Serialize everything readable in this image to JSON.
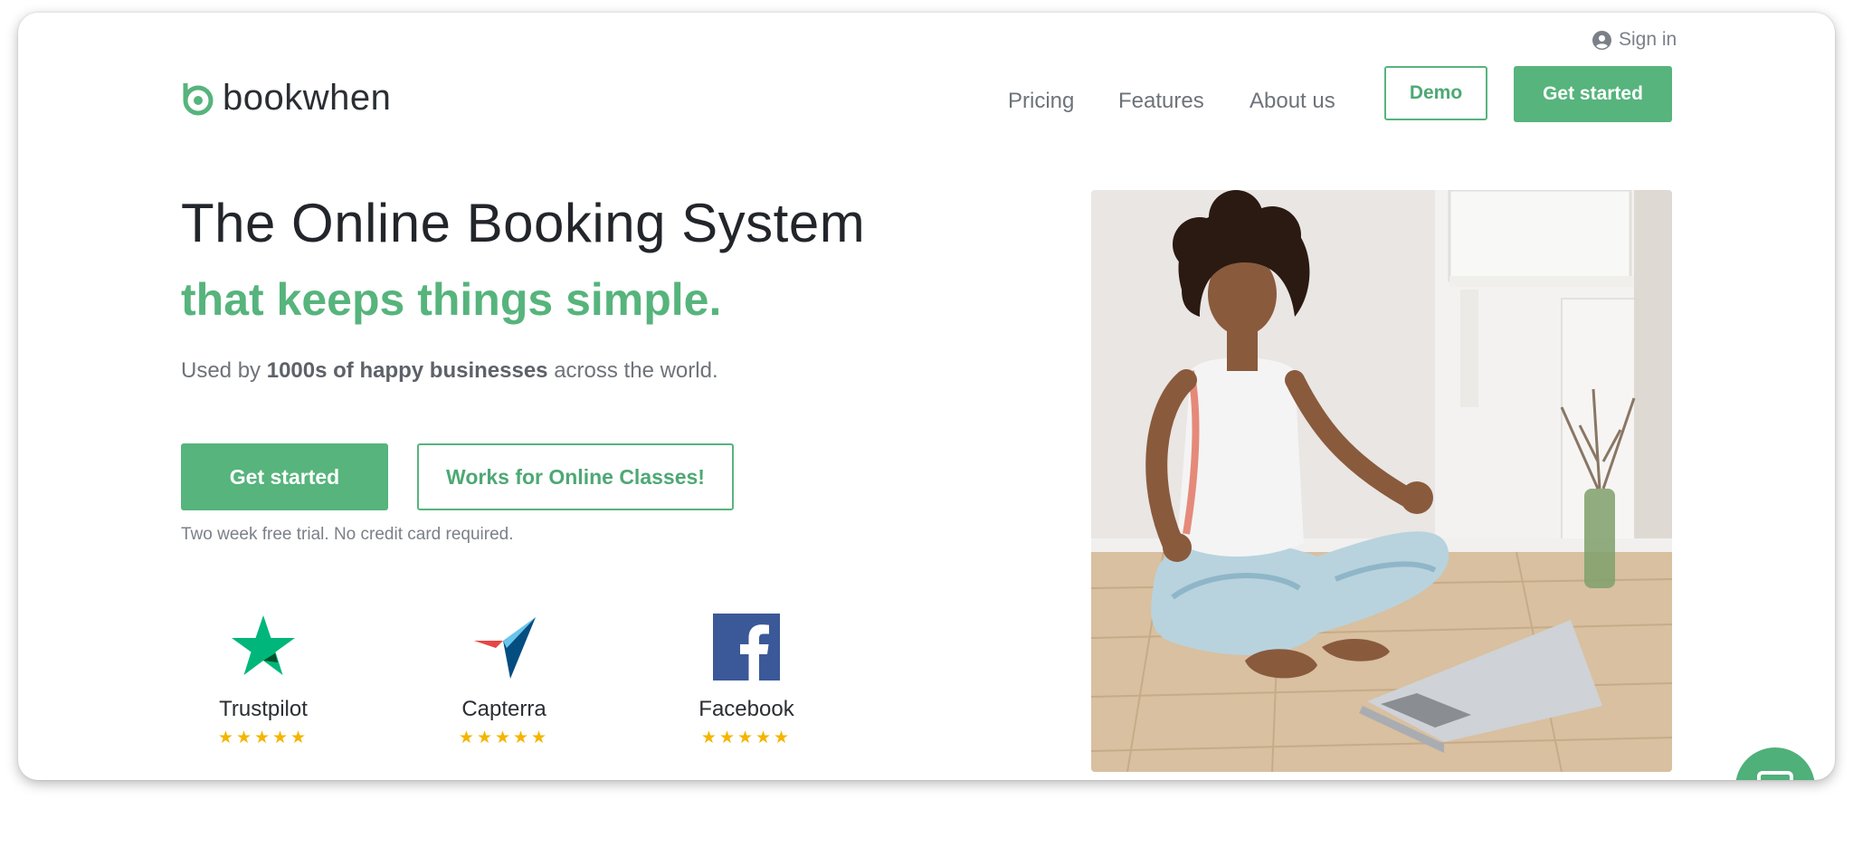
{
  "header": {
    "sign_in": "Sign in",
    "logo_text": "bookwhen",
    "nav": [
      "Pricing",
      "Features",
      "About us"
    ],
    "demo_label": "Demo",
    "get_started_label": "Get started"
  },
  "hero": {
    "title": "The Online Booking System",
    "subtitle": "that keeps things simple.",
    "tagline_prefix": "Used by",
    "tagline_bold": "1000s of happy businesses",
    "tagline_suffix": "across the world.",
    "cta_primary": "Get started",
    "cta_secondary": "Works for Online Classes!",
    "trial_note": "Two week free trial. No credit card required."
  },
  "reviews": [
    {
      "name": "Trustpilot",
      "stars": "★★★★★",
      "rating": 5,
      "icon": "trustpilot-star-icon"
    },
    {
      "name": "Capterra",
      "stars": "★★★★★",
      "rating": 5,
      "icon": "capterra-icon"
    },
    {
      "name": "Facebook",
      "stars": "★★★★★",
      "rating": 5,
      "icon": "facebook-icon"
    }
  ],
  "colors": {
    "brand_green": "#56b47c",
    "text_dark": "#22252a",
    "text_muted": "#6e737a",
    "star_yellow": "#f5b400"
  }
}
